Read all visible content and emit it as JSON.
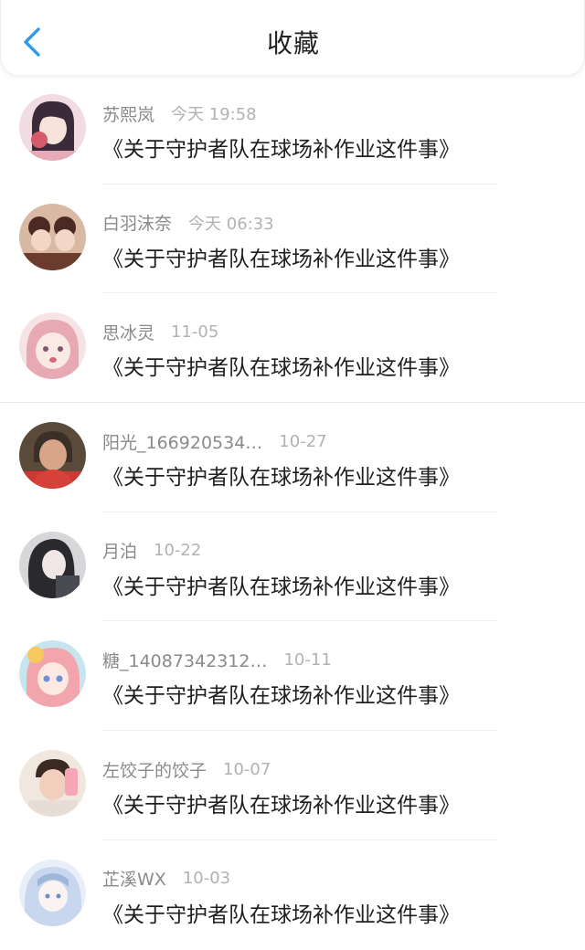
{
  "header": {
    "title": "收藏",
    "back_icon": "chevron-left-icon",
    "accent_color": "#2f9bea"
  },
  "items": [
    {
      "name": "苏熙岚",
      "time": "今天 19:58",
      "message": "《关于守护者队在球场补作业这件事》",
      "avatar_color": "#3a2a3a",
      "avatar_bg": "#f2dce4"
    },
    {
      "name": "白羽沫奈",
      "time": "今天 06:33",
      "message": "《关于守护者队在球场补作业这件事》",
      "avatar_color": "#4a2a22",
      "avatar_bg": "#d9b9a3"
    },
    {
      "name": "思冰灵",
      "time": "11-05",
      "message": "《关于守护者队在球场补作业这件事》",
      "avatar_color": "#e7a9b3",
      "avatar_bg": "#f7e3e6"
    },
    {
      "name": "阳光_166920534…",
      "time": "10-27",
      "message": "《关于守护者队在球场补作业这件事》",
      "avatar_color": "#3a3028",
      "avatar_bg": "#c93a34"
    },
    {
      "name": "月泊",
      "time": "10-22",
      "message": "《关于守护者队在球场补作业这件事》",
      "avatar_color": "#2a2a2e",
      "avatar_bg": "#d8d6d8"
    },
    {
      "name": "糖_14087342312…",
      "time": "10-11",
      "message": "《关于守护者队在球场补作业这件事》",
      "avatar_color": "#f3a5ae",
      "avatar_bg": "#c6e6ef"
    },
    {
      "name": "左饺子的饺子",
      "time": "10-07",
      "message": "《关于守护者队在球场补作业这件事》",
      "avatar_color": "#3b2a22",
      "avatar_bg": "#f0e7df"
    },
    {
      "name": "芷溪WX",
      "time": "10-03",
      "message": "《关于守护者队在球场补作业这件事》",
      "avatar_color": "#9fb6d8",
      "avatar_bg": "#e9eff8"
    }
  ]
}
